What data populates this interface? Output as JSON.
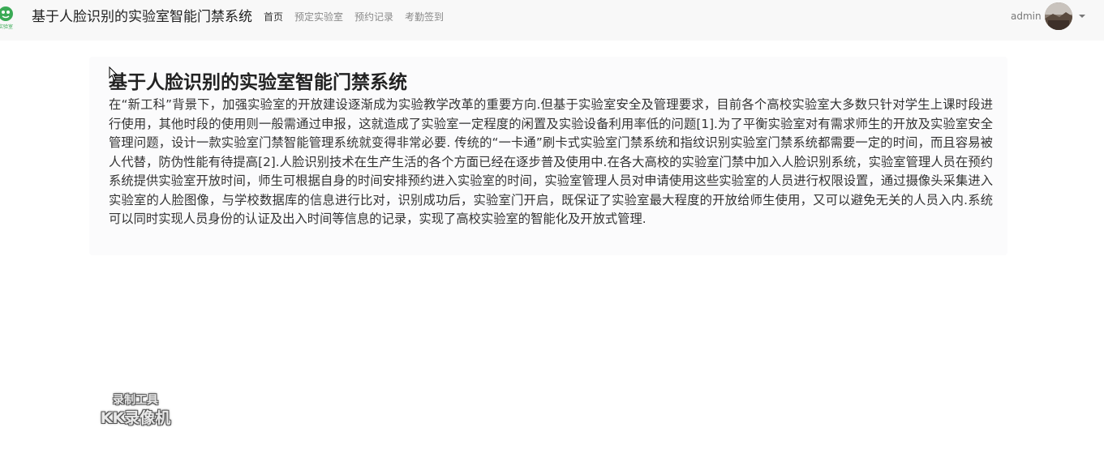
{
  "header": {
    "brand": "基于人脸识别的实验室智能门禁系统",
    "nav": [
      "首页",
      "预定实验室",
      "预约记录",
      "考勤签到"
    ],
    "active_index": 0,
    "logo_icon": "lab-logo-icon",
    "logo_text": "实验室"
  },
  "user": {
    "name": "admin",
    "avatar_icon": "user-avatar"
  },
  "main": {
    "title": "基于人脸识别的实验室智能门禁系统",
    "paragraph": "在“新工科”背景下，加强实验室的开放建设逐渐成为实验教学改革的重要方向.但基于实验室安全及管理要求，目前各个高校实验室大多数只针对学生上课时段进行使用，其他时段的使用则一般需通过申报，这就造成了实验室一定程度的闲置及实验设备利用率低的问题[1].为了平衡实验室对有需求师生的开放及实验室安全管理问题，设计一款实验室门禁智能管理系统就变得非常必要. 传统的“一卡通”刷卡式实验室门禁系统和指纹识别实验室门禁系统都需要一定的时间，而且容易被人代替，防伪性能有待提高[2].人脸识别技术在生产生活的各个方面已经在逐步普及使用中.在各大高校的实验室门禁中加入人脸识别系统，实验室管理人员在预约系统提供实验室开放时间，师生可根据自身的时间安排预约进入实验室的时间，实验室管理人员对申请使用这些实验室的人员进行权限设置，通过摄像头采集进入实验室的人脸图像，与学校数据库的信息进行比对，识别成功后，实验室门开启，既保证了实验室最大程度的开放给师生使用，又可以避免无关的人员入内.系统可以同时实现人员身份的认证及出入时间等信息的记录，实现了高校实验室的智能化及开放式管理."
  },
  "watermark": {
    "line1": "录制工具",
    "line2": "KK录像机"
  },
  "colors": {
    "navbar_bg": "#f8f8f8",
    "jumbotron_bg": "#fbfbfc",
    "logo_green": "#3aaa55"
  }
}
